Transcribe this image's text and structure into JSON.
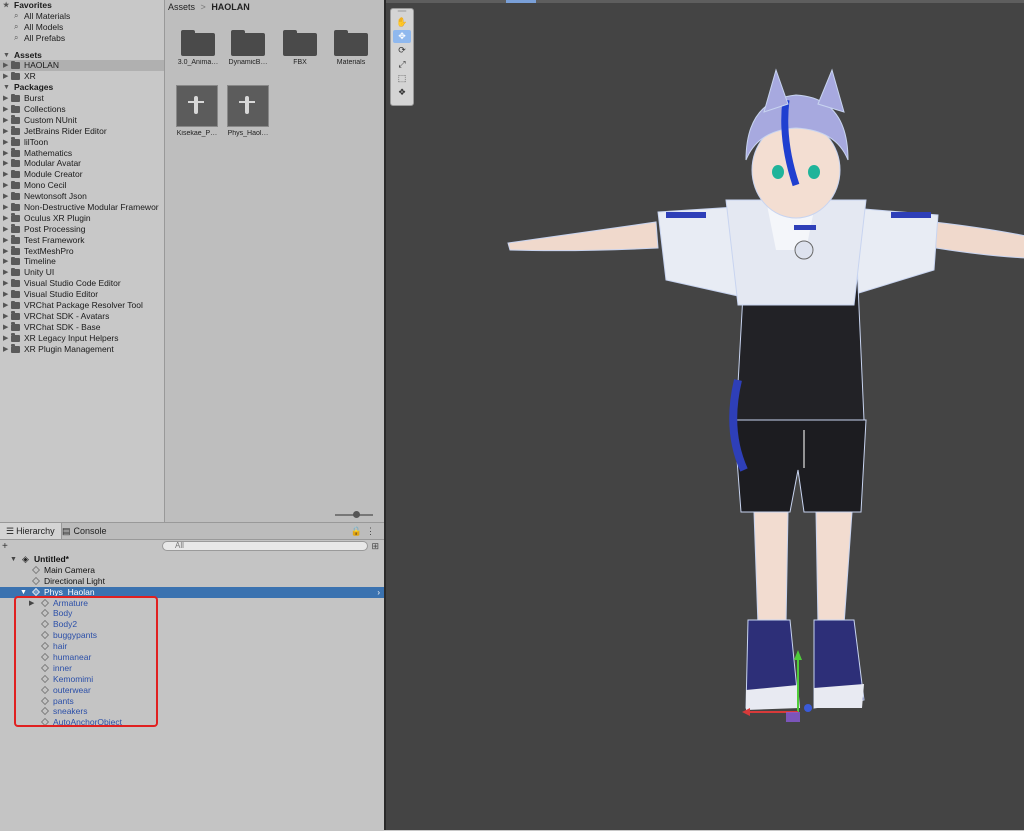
{
  "project": {
    "favorites": {
      "label": "Favorites",
      "items": [
        "All Materials",
        "All Models",
        "All Prefabs"
      ]
    },
    "assets": {
      "label": "Assets",
      "items": [
        "HAOLAN",
        "XR"
      ]
    },
    "packages": {
      "label": "Packages",
      "items": [
        "Burst",
        "Collections",
        "Custom NUnit",
        "JetBrains Rider Editor",
        "lilToon",
        "Mathematics",
        "Modular Avatar",
        "Module Creator",
        "Mono Cecil",
        "Newtonsoft Json",
        "Non-Destructive Modular Framewor",
        "Oculus XR Plugin",
        "Post Processing",
        "Test Framework",
        "TextMeshPro",
        "Timeline",
        "Unity UI",
        "Visual Studio Code Editor",
        "Visual Studio Editor",
        "VRChat Package Resolver Tool",
        "VRChat SDK - Avatars",
        "VRChat SDK - Base",
        "XR Legacy Input Helpers",
        "XR Plugin Management"
      ]
    }
  },
  "browser": {
    "breadcrumb_root": "Assets",
    "breadcrumb_sep": ">",
    "breadcrumb_current": "HAOLAN",
    "folders": [
      "3.0_Anima…",
      "DynamicB…",
      "FBX",
      "Materials"
    ],
    "prefabs": [
      "Kisekae_P…",
      "Phys_Haol…"
    ]
  },
  "hierarchy": {
    "tab_hierarchy": "Hierarchy",
    "tab_console": "Console",
    "add_label": "+",
    "search_placeholder": "All",
    "scene_name": "Untitled*",
    "root_items": [
      "Main Camera",
      "Directional Light"
    ],
    "selected_item": "Phys_Haolan",
    "children": [
      "Armature",
      "Body",
      "Body2",
      "buggypants",
      "hair",
      "humanear",
      "inner",
      "Kemomimi",
      "outerwear",
      "pants",
      "sneakers",
      "AutoAnchorObject"
    ]
  },
  "scene": {
    "tools": [
      "hand-tool",
      "move-tool",
      "rotate-tool",
      "scale-tool",
      "rect-tool",
      "transform-tool"
    ],
    "colors": {
      "background": "#444444",
      "accent": "#3a72b0",
      "highlight": "#e02020"
    }
  }
}
